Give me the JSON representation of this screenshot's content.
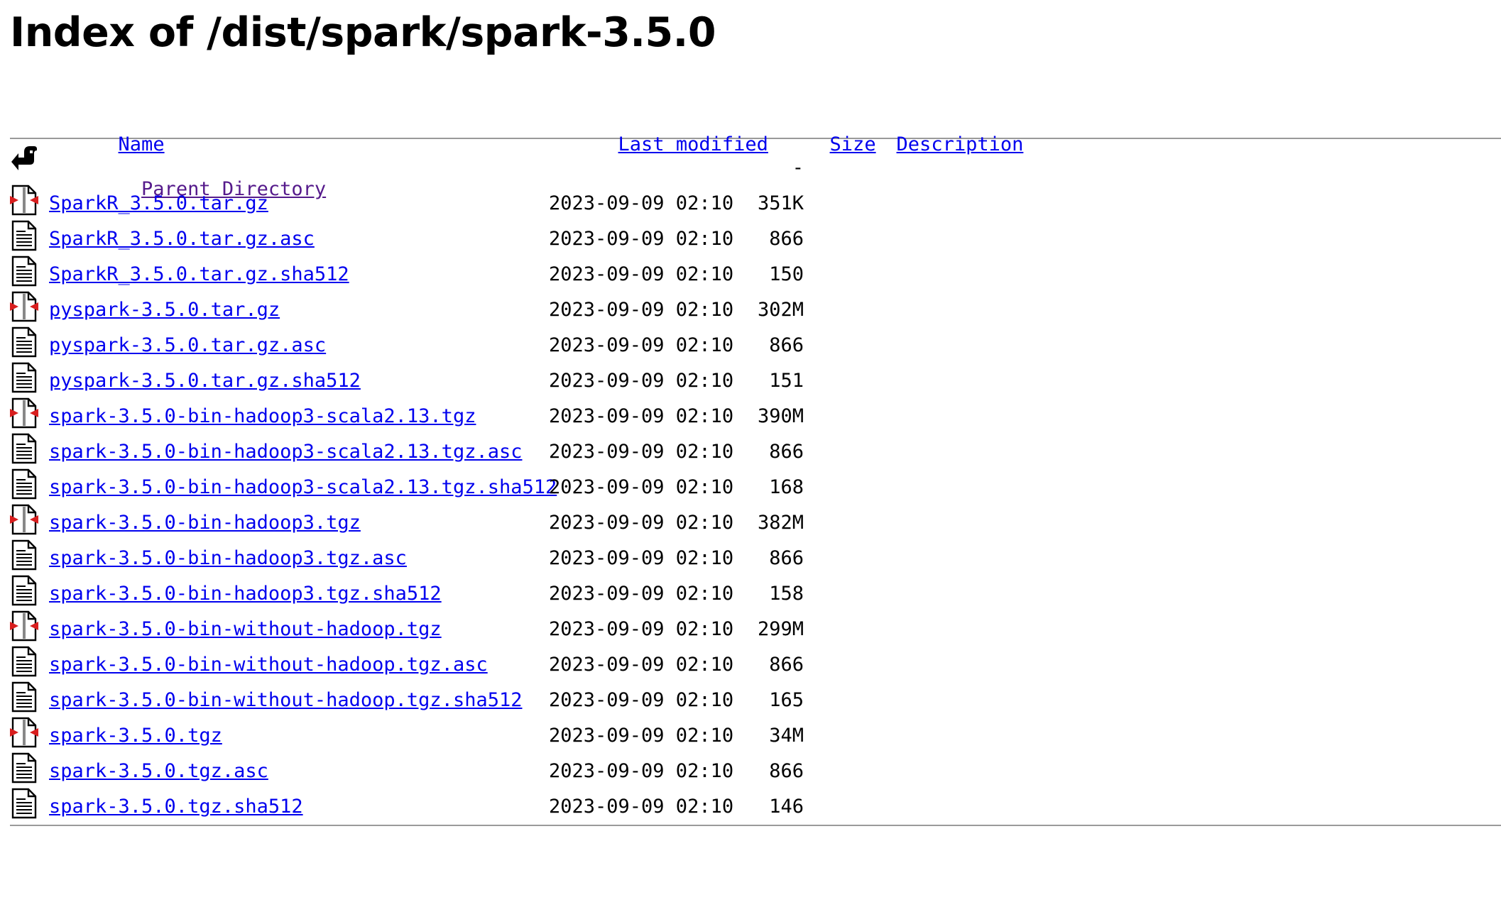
{
  "page": {
    "title": "Index of /dist/spark/spark-3.5.0"
  },
  "columns": {
    "name": "Name",
    "last_modified": "Last modified",
    "size": "Size",
    "description": "Description"
  },
  "parent": {
    "label": "Parent Directory",
    "size": "-",
    "icon": "back-arrow-icon"
  },
  "files": [
    {
      "name": "SparkR_3.5.0.tar.gz",
      "modified": "2023-09-09 02:10",
      "size": "351K",
      "icon": "compressed-icon"
    },
    {
      "name": "SparkR_3.5.0.tar.gz.asc",
      "modified": "2023-09-09 02:10",
      "size": "866",
      "icon": "text-file-icon"
    },
    {
      "name": "SparkR_3.5.0.tar.gz.sha512",
      "modified": "2023-09-09 02:10",
      "size": "150",
      "icon": "text-file-icon"
    },
    {
      "name": "pyspark-3.5.0.tar.gz",
      "modified": "2023-09-09 02:10",
      "size": "302M",
      "icon": "compressed-icon"
    },
    {
      "name": "pyspark-3.5.0.tar.gz.asc",
      "modified": "2023-09-09 02:10",
      "size": "866",
      "icon": "text-file-icon"
    },
    {
      "name": "pyspark-3.5.0.tar.gz.sha512",
      "modified": "2023-09-09 02:10",
      "size": "151",
      "icon": "text-file-icon"
    },
    {
      "name": "spark-3.5.0-bin-hadoop3-scala2.13.tgz",
      "modified": "2023-09-09 02:10",
      "size": "390M",
      "icon": "compressed-icon"
    },
    {
      "name": "spark-3.5.0-bin-hadoop3-scala2.13.tgz.asc",
      "modified": "2023-09-09 02:10",
      "size": "866",
      "icon": "text-file-icon"
    },
    {
      "name": "spark-3.5.0-bin-hadoop3-scala2.13.tgz.sha512",
      "modified": "2023-09-09 02:10",
      "size": "168",
      "icon": "text-file-icon"
    },
    {
      "name": "spark-3.5.0-bin-hadoop3.tgz",
      "modified": "2023-09-09 02:10",
      "size": "382M",
      "icon": "compressed-icon"
    },
    {
      "name": "spark-3.5.0-bin-hadoop3.tgz.asc",
      "modified": "2023-09-09 02:10",
      "size": "866",
      "icon": "text-file-icon"
    },
    {
      "name": "spark-3.5.0-bin-hadoop3.tgz.sha512",
      "modified": "2023-09-09 02:10",
      "size": "158",
      "icon": "text-file-icon"
    },
    {
      "name": "spark-3.5.0-bin-without-hadoop.tgz",
      "modified": "2023-09-09 02:10",
      "size": "299M",
      "icon": "compressed-icon"
    },
    {
      "name": "spark-3.5.0-bin-without-hadoop.tgz.asc",
      "modified": "2023-09-09 02:10",
      "size": "866",
      "icon": "text-file-icon"
    },
    {
      "name": "spark-3.5.0-bin-without-hadoop.tgz.sha512",
      "modified": "2023-09-09 02:10",
      "size": "165",
      "icon": "text-file-icon"
    },
    {
      "name": "spark-3.5.0.tgz",
      "modified": "2023-09-09 02:10",
      "size": "34M",
      "icon": "compressed-icon"
    },
    {
      "name": "spark-3.5.0.tgz.asc",
      "modified": "2023-09-09 02:10",
      "size": "866",
      "icon": "text-file-icon"
    },
    {
      "name": "spark-3.5.0.tgz.sha512",
      "modified": "2023-09-09 02:10",
      "size": "146",
      "icon": "text-file-icon"
    }
  ],
  "colors": {
    "link": "#0000ee",
    "visited_link": "#551a8b",
    "rule": "#9a9a9a",
    "archive_red": "#d81e1e"
  }
}
